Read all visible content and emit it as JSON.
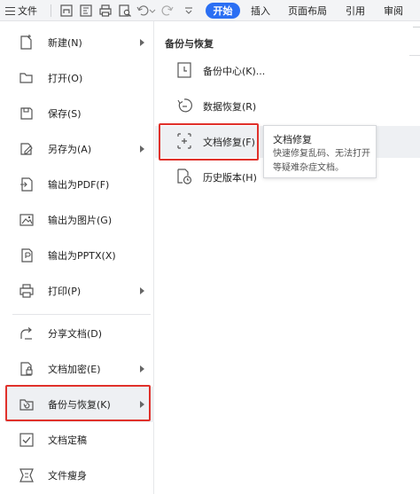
{
  "toolbar": {
    "file_label": "文件",
    "tabs": [
      "开始",
      "插入",
      "页面布局",
      "引用",
      "审阅"
    ],
    "active_tab": "开始",
    "accent_color": "#2b6ff3"
  },
  "left_menu": {
    "items": [
      {
        "label": "新建(N)",
        "icon": "new-file-icon",
        "has_submenu": true
      },
      {
        "label": "打开(O)",
        "icon": "folder-open-icon",
        "has_submenu": false
      },
      {
        "label": "保存(S)",
        "icon": "save-icon",
        "has_submenu": false
      },
      {
        "label": "另存为(A)",
        "icon": "save-as-icon",
        "has_submenu": true
      },
      {
        "label": "输出为PDF(F)",
        "icon": "export-pdf-icon",
        "has_submenu": false
      },
      {
        "label": "输出为图片(G)",
        "icon": "export-image-icon",
        "has_submenu": false
      },
      {
        "label": "输出为PPTX(X)",
        "icon": "export-pptx-icon",
        "has_submenu": false
      },
      {
        "label": "打印(P)",
        "icon": "print-icon",
        "has_submenu": true
      },
      {
        "label": "分享文档(D)",
        "icon": "share-icon",
        "has_submenu": false
      },
      {
        "label": "文档加密(E)",
        "icon": "encrypt-icon",
        "has_submenu": true
      },
      {
        "label": "备份与恢复(K)",
        "icon": "backup-icon",
        "has_submenu": true,
        "active": true
      },
      {
        "label": "文档定稿",
        "icon": "finalize-icon",
        "has_submenu": false
      },
      {
        "label": "文件瘦身",
        "icon": "slim-icon",
        "has_submenu": false
      }
    ]
  },
  "submenu": {
    "title": "备份与恢复",
    "items": [
      {
        "label": "备份中心(K)...",
        "icon": "backup-center-icon"
      },
      {
        "label": "数据恢复(R)",
        "icon": "data-recovery-icon"
      },
      {
        "label": "文档修复(F)",
        "icon": "doc-repair-icon",
        "hover": true
      },
      {
        "label": "历史版本(H)",
        "icon": "history-version-icon"
      }
    ]
  },
  "tooltip": {
    "title": "文档修复",
    "description": "快速修复乱码、无法打开等疑难杂症文档。"
  },
  "highlight_color": "#e0312b"
}
